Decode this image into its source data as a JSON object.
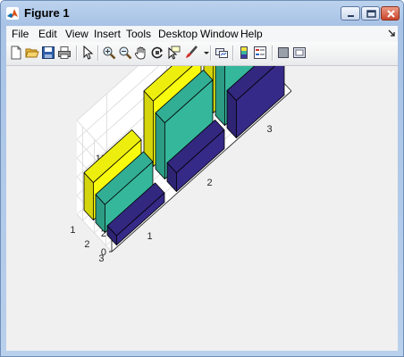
{
  "window": {
    "title": "Figure 1"
  },
  "menu": [
    "File",
    "Edit",
    "View",
    "Insert",
    "Tools",
    "Desktop",
    "Window",
    "Help"
  ],
  "toolbar": [
    {
      "icon": "new-figure-icon"
    },
    {
      "icon": "open-file-icon"
    },
    {
      "icon": "save-figure-icon"
    },
    {
      "icon": "print-figure-icon"
    },
    {
      "icon": "edit-plot-icon"
    },
    {
      "icon": "zoom-in-icon"
    },
    {
      "icon": "zoom-out-icon"
    },
    {
      "icon": "pan-icon"
    },
    {
      "icon": "rotate-3d-icon"
    },
    {
      "icon": "data-cursor-icon"
    },
    {
      "icon": "brush-icon"
    },
    {
      "icon": "link-plot-icon"
    },
    {
      "icon": "insert-colorbar-icon"
    },
    {
      "icon": "insert-legend-icon"
    },
    {
      "icon": "hide-plot-tools-icon"
    },
    {
      "icon": "show-plot-tools-icon"
    }
  ],
  "chart_data": {
    "type": "bar3",
    "rows": [
      "1",
      "2",
      "3"
    ],
    "columns": [
      "1",
      "2",
      "3"
    ],
    "series": [
      {
        "values": [
          4,
          7,
          10
        ],
        "color": "#f9fb0e"
      },
      {
        "values": [
          3,
          6,
          7
        ],
        "color": "#35b79c"
      },
      {
        "values": [
          1,
          2,
          4
        ],
        "color": "#352a87"
      }
    ],
    "zlim": [
      0,
      10
    ],
    "zticks": [
      "0",
      "2",
      "4",
      "6",
      "8",
      "10"
    ],
    "grid": true
  }
}
